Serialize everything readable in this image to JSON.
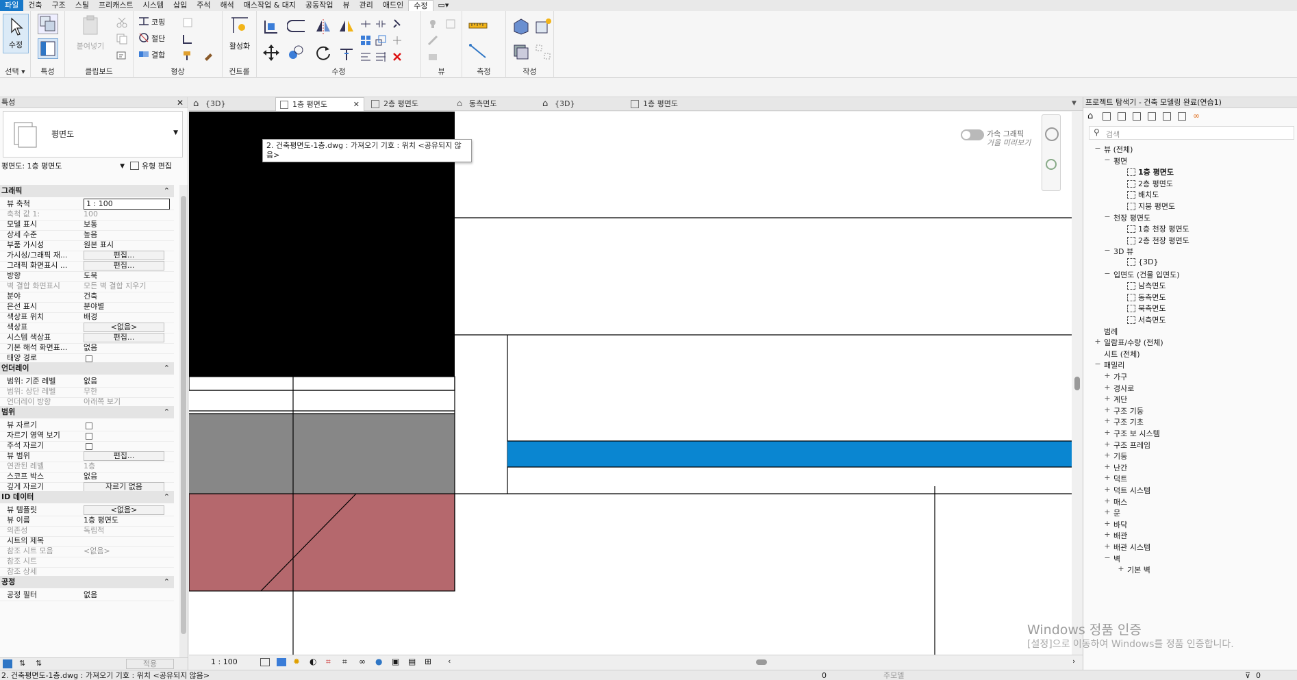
{
  "menu": {
    "items": [
      "파일",
      "건축",
      "구조",
      "스틸",
      "프리캐스트",
      "시스템",
      "삽입",
      "주석",
      "해석",
      "매스작업 & 대지",
      "공동작업",
      "뷰",
      "관리",
      "애드인",
      "수정"
    ],
    "active": "수정"
  },
  "ribbon": {
    "panels": {
      "select": "선택",
      "properties": "특성",
      "clipboard": "클립보드",
      "geometry": "형상",
      "controls": "컨트롤",
      "modify": "수정",
      "view": "뷰",
      "measure": "측정",
      "create": "작성"
    },
    "modify_btn": "수정",
    "paste_btn": "붙여넣기",
    "activate_btn": "활성화",
    "cope": "코핑",
    "cut": "절단",
    "join": "결합",
    "select_dropdown": "선택 ▾"
  },
  "properties": {
    "title": "특성",
    "type_name": "평면도",
    "selector": "평면도: 1층 평면도",
    "edit_type": "유형 편집",
    "sections": {
      "graphics": "그래픽",
      "underlay": "언더레이",
      "extents": "범위",
      "identity": "ID 데이터",
      "phasing": "공정"
    },
    "graphics_rows": [
      {
        "k": "뷰 축척",
        "v": "1 : 100"
      },
      {
        "k": "축척 값    1:",
        "v": "100"
      },
      {
        "k": "모델 표시",
        "v": "보통"
      },
      {
        "k": "상세 수준",
        "v": "높음"
      },
      {
        "k": "부품 가시성",
        "v": "원본 표시"
      },
      {
        "k": "가시성/그래픽 재...",
        "v": "편집..."
      },
      {
        "k": "그래픽 화면표시 ...",
        "v": "편집..."
      },
      {
        "k": "방향",
        "v": "도북"
      },
      {
        "k": "벽 결합 화면표시",
        "v": "모든 벽 결합 지우기"
      },
      {
        "k": "분야",
        "v": "건축"
      },
      {
        "k": "은선 표시",
        "v": "분야별"
      },
      {
        "k": "색상표 위치",
        "v": "배경"
      },
      {
        "k": "색상표",
        "v": "<없음>"
      },
      {
        "k": "시스템 색상표",
        "v": "편집..."
      },
      {
        "k": "기본 해석 화면표...",
        "v": "없음"
      },
      {
        "k": "태양 경로",
        "v": ""
      }
    ],
    "underlay_rows": [
      {
        "k": "범위: 기준 레벨",
        "v": "없음"
      },
      {
        "k": "범위: 상단 레벨",
        "v": "무한"
      },
      {
        "k": "언더레이 방향",
        "v": "아래쪽 보기"
      }
    ],
    "extents_rows": [
      {
        "k": "뷰 자르기",
        "v": ""
      },
      {
        "k": "자르기 영역 보기",
        "v": ""
      },
      {
        "k": "주석 자르기",
        "v": ""
      },
      {
        "k": "뷰 범위",
        "v": "편집..."
      },
      {
        "k": "연관된 레벨",
        "v": "1층"
      },
      {
        "k": "스코프 박스",
        "v": "없음"
      },
      {
        "k": "깊게 자르기",
        "v": "자르기 없음"
      }
    ],
    "identity_rows": [
      {
        "k": "뷰 템플릿",
        "v": "<없음>"
      },
      {
        "k": "뷰 이름",
        "v": "1층 평면도"
      },
      {
        "k": "의존성",
        "v": "독립적"
      },
      {
        "k": "시트의 제목",
        "v": ""
      },
      {
        "k": "참조 시트 모음",
        "v": "<없음>"
      },
      {
        "k": "참조 시트",
        "v": ""
      },
      {
        "k": "참조 상세",
        "v": ""
      }
    ],
    "phasing_row": {
      "k": "공정 필터",
      "v": "없음"
    },
    "apply": "적용"
  },
  "tabs": [
    {
      "label": "{3D}",
      "icon": "house-icon",
      "active": false
    },
    {
      "label": "1층 평면도",
      "icon": "floorplan-icon",
      "active": true
    },
    {
      "label": "2층 평면도",
      "icon": "floorplan-icon",
      "active": false
    },
    {
      "label": "동측면도",
      "icon": "elevation-icon",
      "active": false
    },
    {
      "label": "{3D}",
      "icon": "house-icon",
      "active": false
    },
    {
      "label": "1층 평면도",
      "icon": "floorplan-icon",
      "active": false
    }
  ],
  "canvas": {
    "tooltip": "2. 건축평면도-1층.dwg : 가져오기 기호 : 위치 <공유되지 않음>",
    "accel_label_1": "가속 그래픽",
    "accel_label_2": "거을 미리보기",
    "colors": {
      "black": "#000000",
      "gray": "#878787",
      "rose": "#b5686d",
      "blue": "#0a86d1"
    }
  },
  "viewbar": {
    "scale": "1 : 100"
  },
  "browser": {
    "title": "프로젝트 탐색기 - 건축 모델링 완료(연습1)",
    "search_placeholder": "검색",
    "nodes": [
      {
        "label": "뷰 (전체)",
        "level": 0,
        "pm": "−",
        "bold": false
      },
      {
        "label": "평면",
        "level": 1,
        "pm": "−"
      },
      {
        "label": "1층 평면도",
        "level": 2,
        "pm": "",
        "bold": true
      },
      {
        "label": "2층 평면도",
        "level": 2,
        "pm": ""
      },
      {
        "label": "배치도",
        "level": 2,
        "pm": ""
      },
      {
        "label": "지붕 평면도",
        "level": 2,
        "pm": ""
      },
      {
        "label": "천장 평면도",
        "level": 1,
        "pm": "−"
      },
      {
        "label": "1층 천장 평면도",
        "level": 2,
        "pm": ""
      },
      {
        "label": "2층 천장 평면도",
        "level": 2,
        "pm": ""
      },
      {
        "label": "3D 뷰",
        "level": 1,
        "pm": "−"
      },
      {
        "label": "{3D}",
        "level": 2,
        "pm": ""
      },
      {
        "label": "입면도 (건물 입면도)",
        "level": 1,
        "pm": "−"
      },
      {
        "label": "남측면도",
        "level": 2,
        "pm": ""
      },
      {
        "label": "동측면도",
        "level": 2,
        "pm": ""
      },
      {
        "label": "북측면도",
        "level": 2,
        "pm": ""
      },
      {
        "label": "서측면도",
        "level": 2,
        "pm": ""
      },
      {
        "label": "범례",
        "level": 0,
        "pm": ""
      },
      {
        "label": "일람표/수량 (전체)",
        "level": 0,
        "pm": "+"
      },
      {
        "label": "시트 (전체)",
        "level": 0,
        "pm": ""
      },
      {
        "label": "패밀리",
        "level": 0,
        "pm": "−"
      },
      {
        "label": "가구",
        "level": 1,
        "pm": "+"
      },
      {
        "label": "경사로",
        "level": 1,
        "pm": "+"
      },
      {
        "label": "계단",
        "level": 1,
        "pm": "+"
      },
      {
        "label": "구조 기둥",
        "level": 1,
        "pm": "+"
      },
      {
        "label": "구조 기초",
        "level": 1,
        "pm": "+"
      },
      {
        "label": "구조 보 시스템",
        "level": 1,
        "pm": "+"
      },
      {
        "label": "구조 프레임",
        "level": 1,
        "pm": "+"
      },
      {
        "label": "기둥",
        "level": 1,
        "pm": "+"
      },
      {
        "label": "난간",
        "level": 1,
        "pm": "+"
      },
      {
        "label": "덕트",
        "level": 1,
        "pm": "+"
      },
      {
        "label": "덕트 시스템",
        "level": 1,
        "pm": "+"
      },
      {
        "label": "매스",
        "level": 1,
        "pm": "+"
      },
      {
        "label": "문",
        "level": 1,
        "pm": "+"
      },
      {
        "label": "바닥",
        "level": 1,
        "pm": "+"
      },
      {
        "label": "배관",
        "level": 1,
        "pm": "+"
      },
      {
        "label": "배관 시스템",
        "level": 1,
        "pm": "+"
      },
      {
        "label": "벽",
        "level": 1,
        "pm": "−"
      },
      {
        "label": "기본 벽",
        "level": 2,
        "pm": "+"
      }
    ]
  },
  "statusbar": {
    "text": "2. 건축평면도-1층.dwg : 가져오기 기호 : 위치 <공유되지 않음>",
    "zoom": "0",
    "model": "주모델"
  },
  "watermark": {
    "line1": "Windows 정품 인증",
    "line2": "[설정]으로 이동하여 Windows를 정품 인증합니다."
  }
}
